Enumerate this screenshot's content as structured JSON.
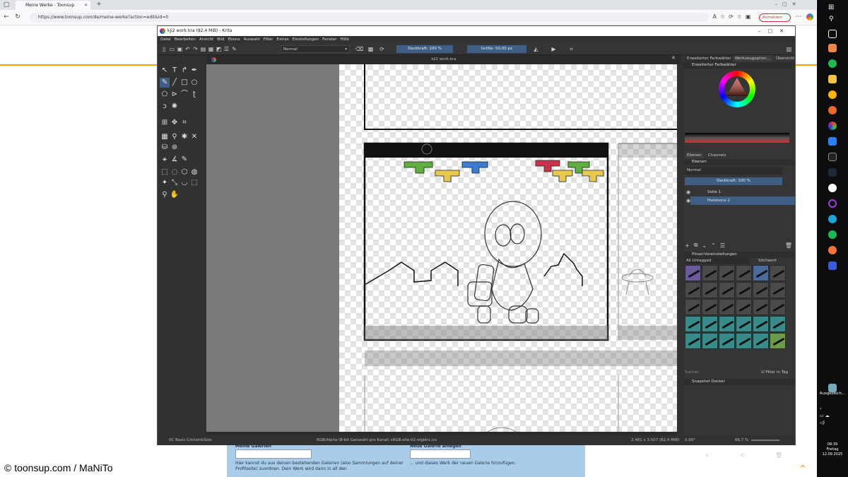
{
  "browser": {
    "tab_title": "Meine Werke - Toonsup",
    "url": "https://www.toonsup.com/de/meine-werke?action=edit&id=0",
    "signin_label": "Anmelden"
  },
  "webpage": {
    "gallery_heading": "Meine Galerien",
    "gallery_text": "Hier kannst du aus deinen bestehenden Galerien (also Sammlungen auf deiner Profilseite) zuordnen. Dein Werk wird dann in all den",
    "new_gallery_heading": "Neue Galerie anlegen",
    "new_gallery_text": "... und dieses Werk der neuen Galerie hinzufügen.",
    "copyright": "© toonsup.com / MaNiTo"
  },
  "krita": {
    "title": "kji2 work.kra (82,4 MiB)  - Krita",
    "menu": [
      "Datei",
      "Bearbeiten",
      "Ansicht",
      "Bild",
      "Ebene",
      "Auswahl",
      "Filter",
      "Extras",
      "Einstellungen",
      "Fenster",
      "Hilfe"
    ],
    "blend_mode": "Normal",
    "opacity_label": "Deckkraft: 100 %",
    "size_label": "Größe: 50,00 px",
    "document_tab": "kji2 work.kra",
    "status": {
      "brush": "0C Basic:CircleInkSize",
      "color_space": "RGB/Alpha (8-bit Ganzzahl pro Kanal)  sRGB-elle-V2-srgbtrc.icc",
      "dimensions": "2.481 x 3.507 (82,4 MiB)",
      "rotation": "0,00°",
      "zoom": "66,7 %"
    },
    "dockers": {
      "tabs": [
        "Erweiterter Farbwähler",
        "Werkzeugoption...",
        "Übersicht"
      ],
      "color_docker_title": "Erweiterter Farbwähler",
      "layer_tabs": [
        "Ebenen",
        "Channels"
      ],
      "layers_title": "Ebenen",
      "layer_blend": "Normal",
      "layer_opacity": "Deckkraft:  100 %",
      "layers": [
        "Seite 1",
        "Malebene 2"
      ],
      "brush_presets_title": "Pinsel-Voreinstellungen",
      "brush_filter": "All Untagged",
      "brush_tag_label": "Stichwort",
      "search_placeholder": "Suchen",
      "filter_in_tag": "Filter in Tag",
      "snapshot_title": "Snapshot Docker"
    }
  },
  "taskbar": {
    "app_label": "Ausgezeich...",
    "time": "08:39",
    "day": "Freitag",
    "date": "12.09.2025"
  },
  "colors": {
    "accent_orange": "#f0a500",
    "krita_slider_blue": "#3f5e83",
    "gallery_blue": "#a9cde8",
    "tetris_green": "#5fae3e",
    "tetris_yellow": "#e8c94b",
    "tetris_blue": "#3a7bd5",
    "tetris_red": "#c8324a"
  }
}
